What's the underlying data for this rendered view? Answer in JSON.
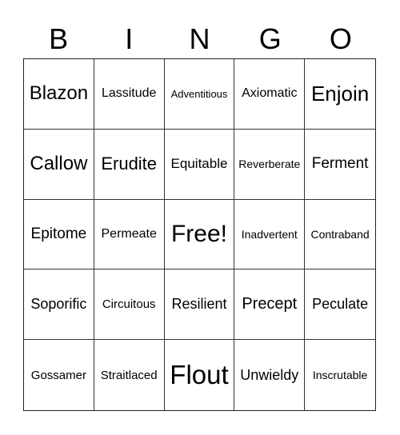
{
  "header": {
    "letters": [
      "B",
      "I",
      "N",
      "G",
      "O"
    ]
  },
  "board": {
    "rows": [
      [
        "Blazon",
        "Lassitude",
        "Adventitious",
        "Axiomatic",
        "Enjoin"
      ],
      [
        "Callow",
        "Erudite",
        "Equitable",
        "Reverberate",
        "Ferment"
      ],
      [
        "Epitome",
        "Permeate",
        "Free!",
        "Inadvertent",
        "Contraband"
      ],
      [
        "Soporific",
        "Circuitous",
        "Resilient",
        "Precept",
        "Peculate"
      ],
      [
        "Gossamer",
        "Straitlaced",
        "Flout",
        "Unwieldy",
        "Inscrutable"
      ]
    ]
  }
}
